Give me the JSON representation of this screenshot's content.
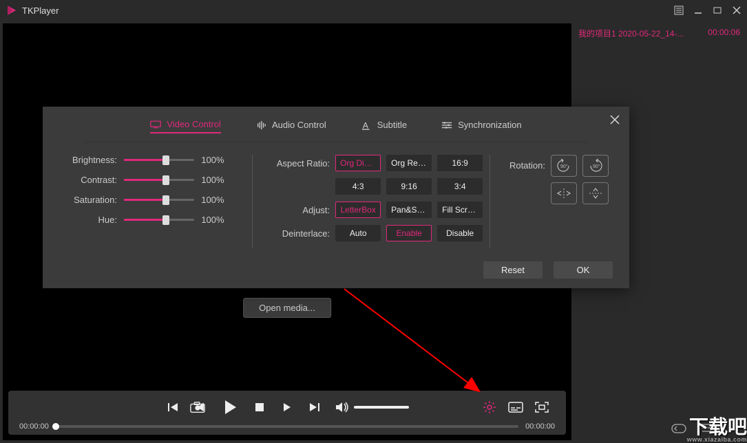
{
  "app": {
    "name": "TKPlayer"
  },
  "playlist": {
    "items": [
      {
        "name": "我的项目1 2020-05-22_14-...",
        "duration": "00:00:06"
      }
    ]
  },
  "open_media_label": "Open media...",
  "player": {
    "current_time": "00:00:00",
    "total_time": "00:00:00"
  },
  "dialog": {
    "tabs": {
      "video": "Video Control",
      "audio": "Audio Control",
      "subtitle": "Subtitle",
      "sync": "Synchronization"
    },
    "sliders": {
      "brightness": {
        "label": "Brightness:",
        "value": "100%",
        "pct": 60
      },
      "contrast": {
        "label": "Contrast:",
        "value": "100%",
        "pct": 60
      },
      "saturation": {
        "label": "Saturation:",
        "value": "100%",
        "pct": 60
      },
      "hue": {
        "label": "Hue:",
        "value": "100%",
        "pct": 60
      }
    },
    "aspect": {
      "label": "Aspect Ratio:",
      "options": [
        "Org Display",
        "Org Res...",
        "16:9",
        "4:3",
        "9:16",
        "3:4"
      ],
      "selected": 0
    },
    "adjust": {
      "label": "Adjust:",
      "options": [
        "LetterBox",
        "Pan&Scan",
        "Fill Screen"
      ],
      "selected": 0
    },
    "deinterlace": {
      "label": "Deinterlace:",
      "options": [
        "Auto",
        "Enable",
        "Disable"
      ],
      "selected": 1
    },
    "rotation_label": "Rotation:",
    "footer": {
      "reset": "Reset",
      "ok": "OK"
    }
  },
  "watermark": {
    "big": "下载吧",
    "small": "www.xiazaiba.com"
  }
}
